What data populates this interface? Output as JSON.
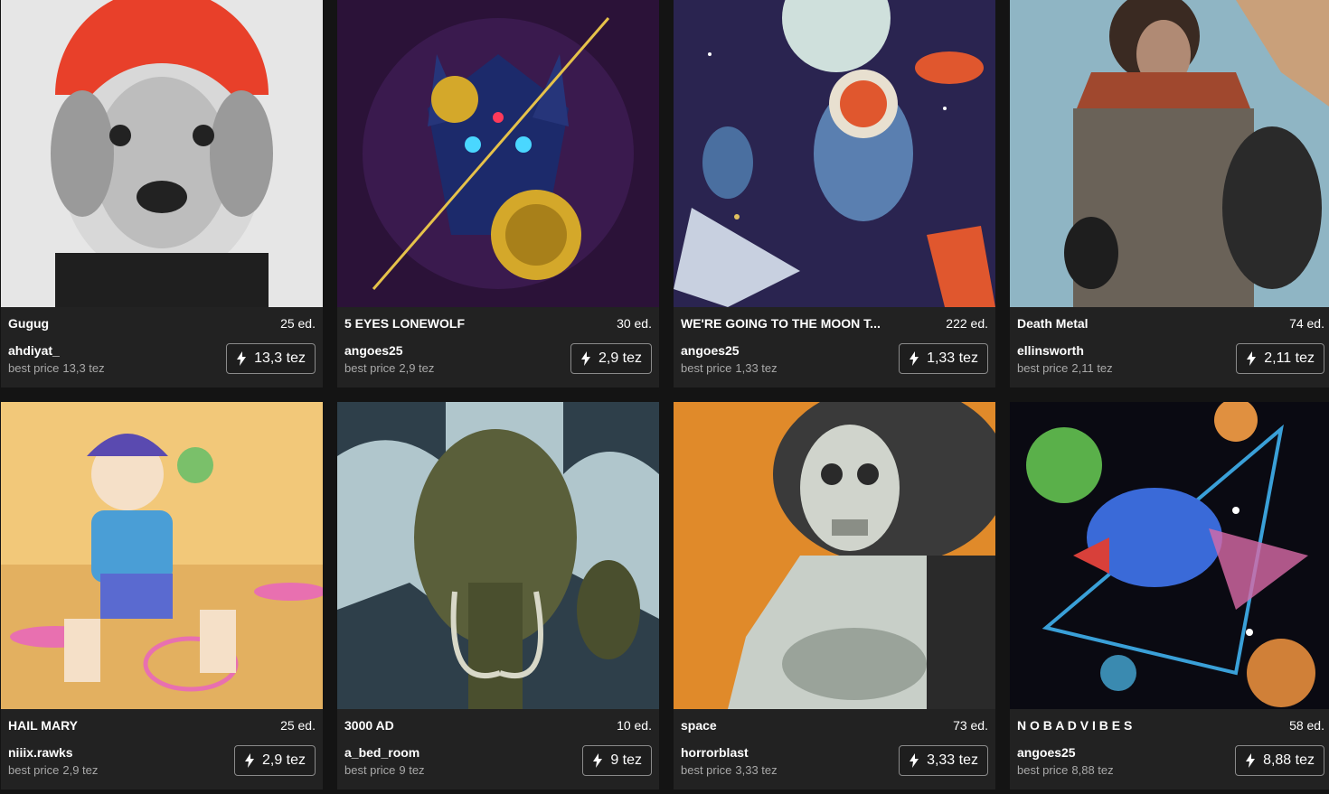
{
  "cards": [
    {
      "title": "Gugug",
      "editions": "25 ed.",
      "artist": "ahdiyat_",
      "best_price_label": "best price",
      "best_price": "13,3 tez",
      "price": "13,3 tez",
      "thumb_colors": [
        "#e6e6e6",
        "#e8402a",
        "#222222"
      ]
    },
    {
      "title": "5 EYES LONEWOLF",
      "editions": "30 ed.",
      "artist": "angoes25",
      "best_price_label": "best price",
      "best_price": "2,9 tez",
      "price": "2,9 tez",
      "thumb_colors": [
        "#2b1238",
        "#1c2a6b",
        "#d4a82a"
      ]
    },
    {
      "title": "WE'RE GOING TO THE MOON T...",
      "editions": "222 ed.",
      "artist": "angoes25",
      "best_price_label": "best price",
      "best_price": "1,33 tez",
      "price": "1,33 tez",
      "thumb_colors": [
        "#2a2450",
        "#e0572e",
        "#5a7fb0"
      ]
    },
    {
      "title": "Death Metal",
      "editions": "74 ed.",
      "artist": "ellinsworth",
      "best_price_label": "best price",
      "best_price": "2,11 tez",
      "price": "2,11 tez",
      "thumb_colors": [
        "#8fb5c4",
        "#7a4a3a",
        "#2a2a2a"
      ]
    },
    {
      "title": "HAIL MARY",
      "editions": "25 ed.",
      "artist": "niiix.rawks",
      "best_price_label": "best price",
      "best_price": "2,9 tez",
      "price": "2,9 tez",
      "thumb_colors": [
        "#f2c879",
        "#4a9ed6",
        "#e870b0"
      ]
    },
    {
      "title": "3000 AD",
      "editions": "10 ed.",
      "artist": "a_bed_room",
      "best_price_label": "best price",
      "best_price": "9 tez",
      "price": "9 tez",
      "thumb_colors": [
        "#2e3f4a",
        "#5a5f3a",
        "#b0c6cc"
      ]
    },
    {
      "title": "space",
      "editions": "73 ed.",
      "artist": "horrorblast",
      "best_price_label": "best price",
      "best_price": "3,33 tez",
      "price": "3,33 tez",
      "thumb_colors": [
        "#e08a2a",
        "#3a3a3a",
        "#c8cfc8"
      ]
    },
    {
      "title": "N O B A D V I B E S",
      "editions": "58 ed.",
      "artist": "angoes25",
      "best_price_label": "best price",
      "best_price": "8,88 tez",
      "price": "8,88 tez",
      "thumb_colors": [
        "#0a0a12",
        "#3aa0d8",
        "#d86aa8"
      ]
    }
  ]
}
